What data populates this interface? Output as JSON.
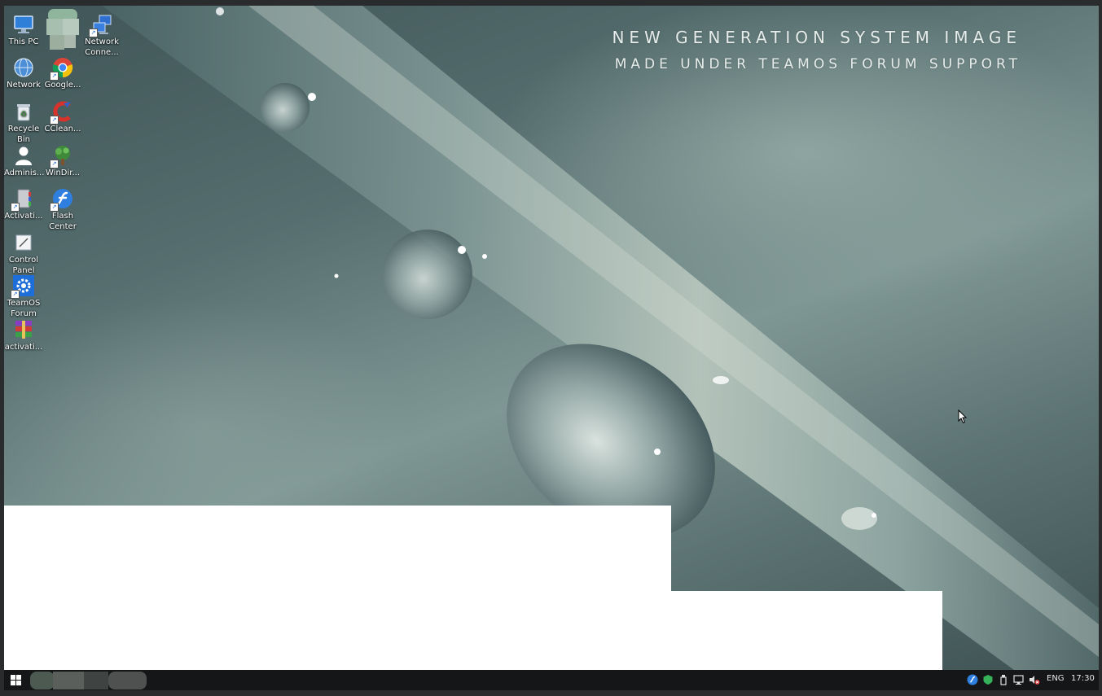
{
  "wallpaper": {
    "line1": "NEW GENERATION SYSTEM IMAGE",
    "line2": "MADE UNDER TEAMOS FORUM SUPPORT"
  },
  "desktop_icons": [
    {
      "label": "This PC",
      "icon": "monitor-icon"
    },
    {
      "label": "Network",
      "icon": "network-globe-icon"
    },
    {
      "label": "Recycle Bin",
      "icon": "recycle-bin-icon"
    },
    {
      "label": "Adminis...",
      "icon": "user-icon"
    },
    {
      "label": "Activati...",
      "icon": "activation-tool-icon"
    },
    {
      "label": "Control Panel",
      "icon": "control-panel-icon"
    },
    {
      "label": "TeamOS Forum",
      "icon": "gear-icon"
    },
    {
      "label": "activati...",
      "icon": "winrar-archive-icon"
    },
    {
      "label": "Google...",
      "icon": "chrome-icon"
    },
    {
      "label": "CClean...",
      "icon": "ccleaner-icon"
    },
    {
      "label": "WinDir...",
      "icon": "tree-icon"
    },
    {
      "label": "Flash Center",
      "icon": "flash-icon"
    },
    {
      "label": "Network Conne...",
      "icon": "network-connections-icon"
    }
  ],
  "taskbar": {
    "language": "ENG",
    "clock": "17:30",
    "tray_icons": [
      "flash-tray-icon",
      "shield-tray-icon",
      "usb-tray-icon",
      "network-tray-icon",
      "volume-muted-icon"
    ]
  },
  "colors": {
    "taskbar": "#151617",
    "desktop_text": "#ffffff",
    "watermark_text": "#e6ecea"
  }
}
